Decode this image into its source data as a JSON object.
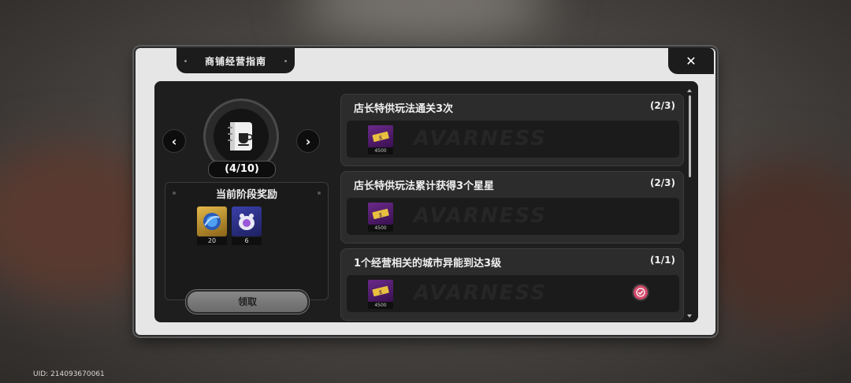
{
  "uid": "UID: 214093670061",
  "panel": {
    "title": "商铺经营指南",
    "close_symbol": "✕"
  },
  "stage": {
    "prev_symbol": "‹",
    "next_symbol": "›",
    "icon": "notebook-coffee-icon",
    "counter": "(4/10)"
  },
  "rewards": {
    "title": "当前阶段奖励",
    "items": [
      {
        "icon": "blue-orb-icon",
        "count": "20"
      },
      {
        "icon": "purple-creature-icon",
        "count": "6"
      }
    ],
    "claim_label": "领取"
  },
  "tasks": [
    {
      "name": "店长特供玩法通关3次",
      "progress": "(2/3)",
      "ticket_amount": "4500",
      "watermark": "AVARNESS",
      "completed": false
    },
    {
      "name": "店长特供玩法累计获得3个星星",
      "progress": "(2/3)",
      "ticket_amount": "4500",
      "watermark": "AVARNESS",
      "completed": false
    },
    {
      "name": "1个经营相关的城市异能到达3级",
      "progress": "(1/1)",
      "ticket_amount": "4500",
      "watermark": "AVARNESS",
      "completed": true
    }
  ],
  "colors": {
    "accent_check": "#d24a6a",
    "ticket_purple": "#6a2a8a",
    "reward_gold": "#c9a23a"
  }
}
